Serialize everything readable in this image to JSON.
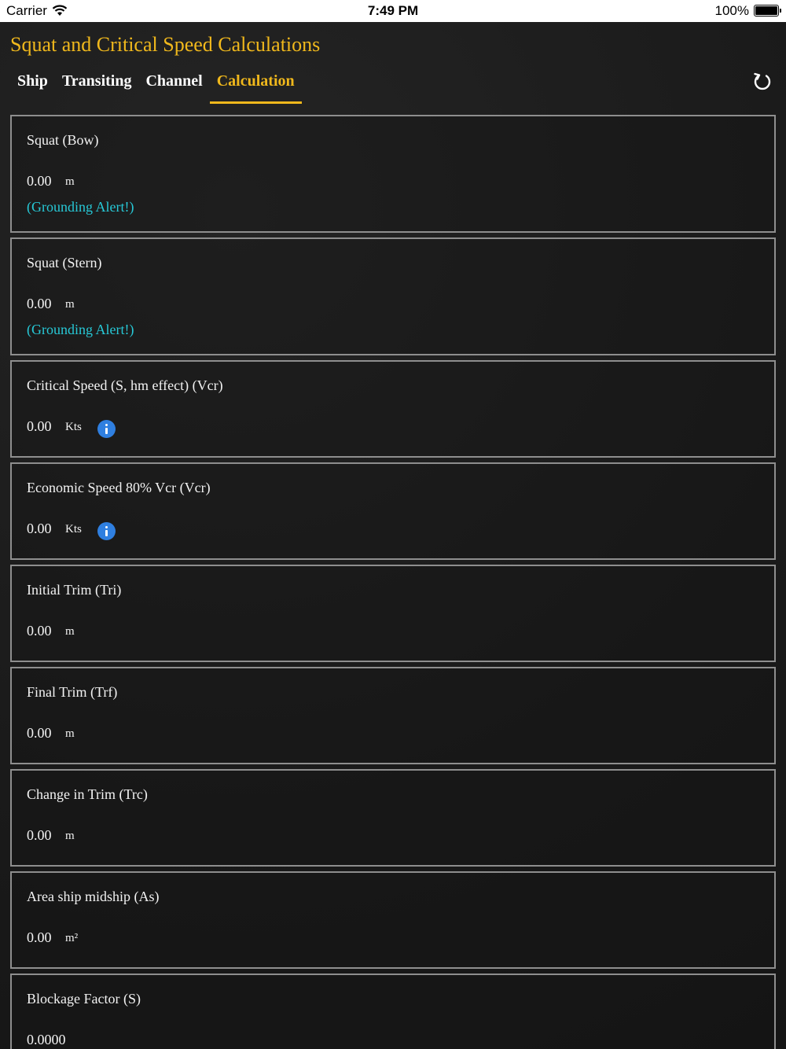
{
  "status_bar": {
    "carrier": "Carrier",
    "time": "7:49 PM",
    "battery": "100%"
  },
  "header": {
    "title": "Squat and Critical Speed Calculations",
    "tabs": [
      {
        "label": "Ship"
      },
      {
        "label": "Transiting"
      },
      {
        "label": "Channel"
      },
      {
        "label": "Calculation"
      }
    ],
    "active_tab": "Calculation"
  },
  "results": [
    {
      "label": "Squat (Bow)",
      "value": "0.00",
      "unit": "m",
      "alert": "(Grounding Alert!)"
    },
    {
      "label": "Squat (Stern)",
      "value": "0.00",
      "unit": "m",
      "alert": "(Grounding Alert!)"
    },
    {
      "label": "Critical Speed (S, hm effect) (Vcr)",
      "value": "0.00",
      "unit": "Kts",
      "info": true
    },
    {
      "label": "Economic Speed 80% Vcr (Vcr)",
      "value": "0.00",
      "unit": "Kts",
      "info": true
    },
    {
      "label": "Initial Trim (Tri)",
      "value": "0.00",
      "unit": "m"
    },
    {
      "label": "Final Trim (Trf)",
      "value": "0.00",
      "unit": "m"
    },
    {
      "label": "Change in Trim (Trc)",
      "value": "0.00",
      "unit": "m"
    },
    {
      "label": "Area ship midship (As)",
      "value": "0.00",
      "unit": "m²"
    },
    {
      "label": "Blockage Factor (S)",
      "value": "0.0000",
      "unit": ""
    }
  ],
  "colors": {
    "accent": "#f0b81c",
    "alert": "#27c8d6",
    "info": "#2f7fe0",
    "border": "#8e8e8e"
  }
}
